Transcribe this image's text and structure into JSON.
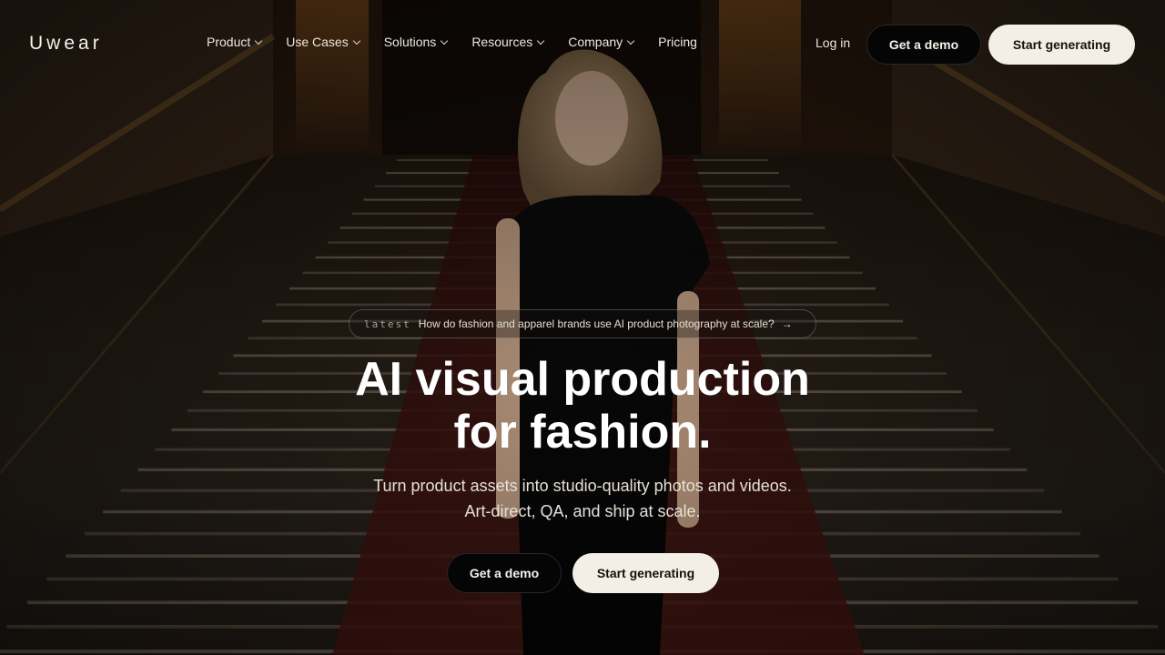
{
  "brand": {
    "logo": "Uwear"
  },
  "nav": {
    "items": [
      {
        "label": "Product",
        "dropdown": true
      },
      {
        "label": "Use Cases",
        "dropdown": true
      },
      {
        "label": "Solutions",
        "dropdown": true
      },
      {
        "label": "Resources",
        "dropdown": true
      },
      {
        "label": "Company",
        "dropdown": true
      },
      {
        "label": "Pricing",
        "dropdown": false
      }
    ],
    "login": "Log in",
    "demo_label": "Get a demo",
    "start_label": "Start generating"
  },
  "hero": {
    "latest_tag": "latest",
    "latest_text": "How do fashion and apparel brands use AI product photography at scale?",
    "latest_arrow": "→",
    "headline_line1": "AI visual production",
    "headline_line2": "for fashion.",
    "sub_line1": "Turn product assets into studio-quality photos and videos.",
    "sub_line2": "Art-direct, QA, and ship at scale.",
    "demo_label": "Get a demo",
    "start_label": "Start generating"
  },
  "colors": {
    "accent_light": "#f3eee6",
    "button_dark": "#060505",
    "text": "#f4f0ea"
  },
  "icons": {
    "dropdown": "chevron-down-icon",
    "link_arrow": "arrow-right-icon"
  }
}
